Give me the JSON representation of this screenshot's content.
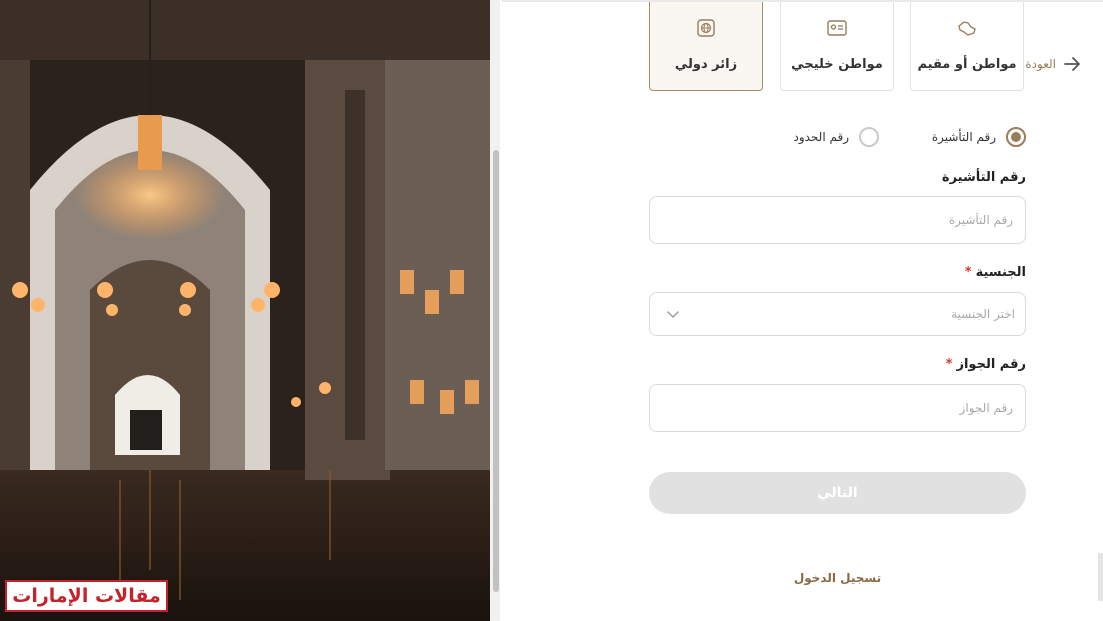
{
  "watermark": {
    "text": "مقالات الإمارات"
  },
  "nav": {
    "back_label": "العودة",
    "back_icon": "arrow-right-icon"
  },
  "tabs": [
    {
      "label": "مواطن أو مقيم",
      "icon": "saudi-map-icon",
      "active": false
    },
    {
      "label": "مواطن خليجي",
      "icon": "id-card-icon",
      "active": false
    },
    {
      "label": "زائر دولي",
      "icon": "globe-icon",
      "active": true
    }
  ],
  "id_type": {
    "options": [
      {
        "label": "رقم التأشيرة",
        "checked": true
      },
      {
        "label": "رقم الحدود",
        "checked": false
      }
    ]
  },
  "form": {
    "visa": {
      "label": "رقم التأشيرة",
      "placeholder": "رقم التأشيرة"
    },
    "nationality": {
      "label": "الجنسية",
      "required_mark": "*",
      "placeholder": "اختر الجنسية"
    },
    "passport": {
      "label": "رقم الجواز",
      "required_mark": "*",
      "placeholder": "رقم الجواز"
    }
  },
  "actions": {
    "next_label": "التالي",
    "login_label": "تسجيل الدخول"
  },
  "colors": {
    "accent": "#9a7c5a",
    "disabled_button": "#e1e1e1",
    "required": "#d23a2b",
    "watermark": "#c4232b"
  }
}
